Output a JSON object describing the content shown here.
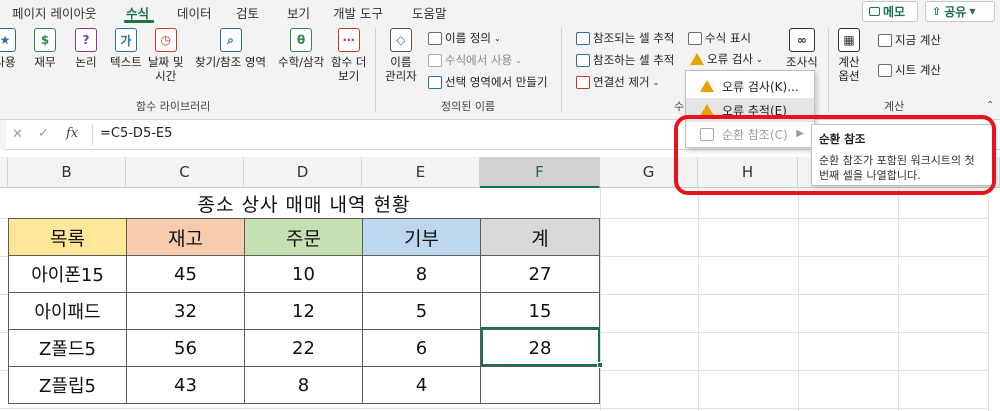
{
  "tabs": [
    "페이지 레이아웃",
    "수식",
    "데이터",
    "검토",
    "보기",
    "개발 도구",
    "도움말"
  ],
  "top_buttons": {
    "memo": "메모",
    "share": "공유"
  },
  "ribbon": {
    "function_library": {
      "label": "함수 라이브러리",
      "items": [
        {
          "top": "",
          "bottom": "사용"
        },
        {
          "top": "",
          "bottom": "재무"
        },
        {
          "top": "",
          "bottom": "논리"
        },
        {
          "top": "",
          "bottom": "텍스트"
        },
        {
          "top": "날짜 및",
          "bottom": "시간"
        },
        {
          "top": "",
          "bottom": "찾기/참조 영역"
        },
        {
          "top": "",
          "bottom": "수학/삼각"
        },
        {
          "top": "함수 더",
          "bottom": "보기"
        }
      ]
    },
    "defined_names": {
      "label": "정의된 이름",
      "name_manager_1": "이름",
      "name_manager_2": "관리자",
      "define_name": "이름 정의",
      "use_in_formula": "수식에서 사용",
      "create_from_selection": "선택 영역에서 만들기"
    },
    "formula_auditing": {
      "label": "수",
      "trace_precedents": "참조되는 셀 추적",
      "trace_dependents": "참조하는 셀 추적",
      "remove_arrows": "연결선 제거",
      "show_formulas": "수식 표시",
      "error_checking": "오류 검사",
      "watch_window": "조사식"
    },
    "calculation": {
      "label": "계산",
      "options_1": "계산",
      "options_2": "옵션",
      "calc_now": "지금 계산",
      "calc_sheet": "시트 계산"
    }
  },
  "menu": {
    "items": [
      "오류 검사(K)...",
      "오류 추적(E)",
      "순환 참조(C)"
    ]
  },
  "tooltip": {
    "title": "순환 참조",
    "body": "순환 참조가 포함된 워크시트의 첫 번째 셀을 나열합니다."
  },
  "formula_bar": {
    "formula": "=C5-D5-E5"
  },
  "columns": [
    "B",
    "C",
    "D",
    "E",
    "F",
    "G",
    "H"
  ],
  "sheet": {
    "title": "종소 상사 매매 내역 현황",
    "headers": [
      "목록",
      "재고",
      "주문",
      "기부",
      "계"
    ],
    "rows": [
      [
        "아이폰15",
        "45",
        "10",
        "8",
        "27"
      ],
      [
        "아이패드",
        "32",
        "12",
        "5",
        "15"
      ],
      [
        "Z폴드5",
        "56",
        "22",
        "6",
        "28"
      ],
      [
        "Z플립5",
        "43",
        "8",
        "4",
        ""
      ]
    ]
  },
  "colors": {
    "header_fill": [
      "#ffe699",
      "#f8cbad",
      "#c6e0b4",
      "#bdd7ee",
      "#d9d9d9"
    ],
    "accent": "#1e7145",
    "highlight": "#e8121c"
  }
}
